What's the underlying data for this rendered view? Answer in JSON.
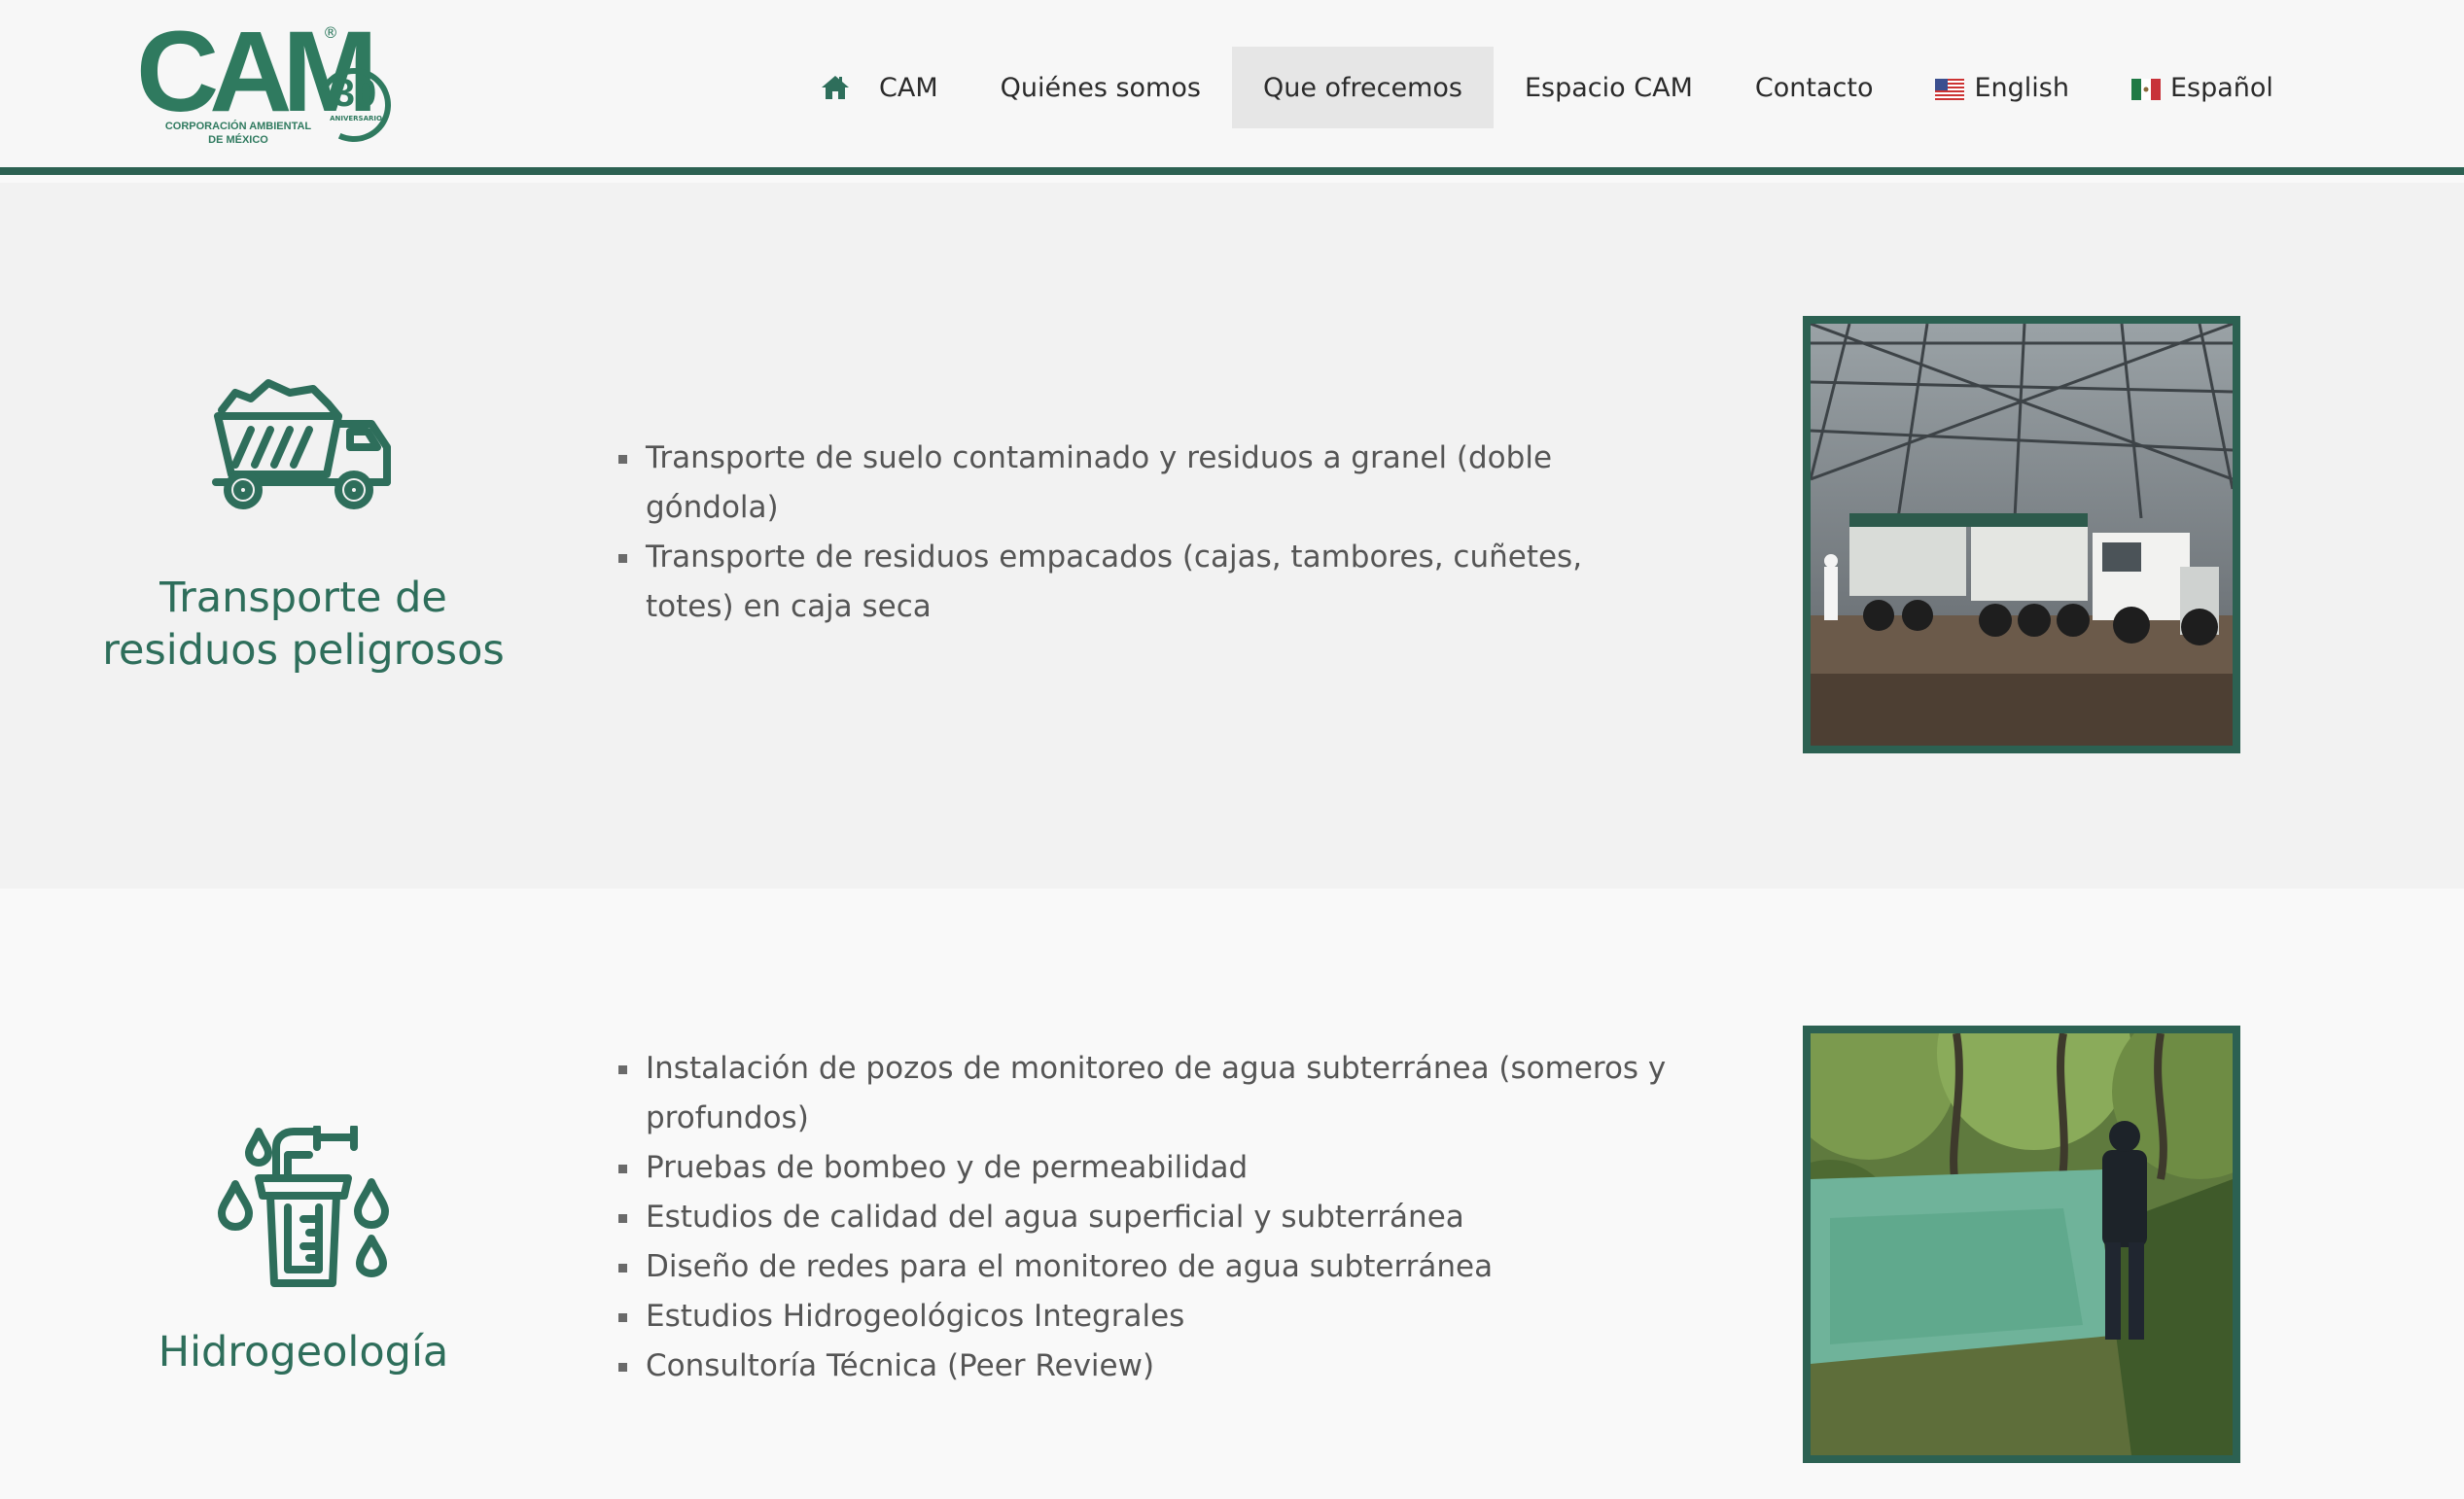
{
  "brand": {
    "logo_text": "CAM",
    "anniversary_number": "30",
    "anniversary_label": "ANIVERSARIO",
    "tagline_line1": "CORPORACIÓN AMBIENTAL",
    "tagline_line2": "DE MÉXICO",
    "registered_mark": "®",
    "color": "#2f7a5f"
  },
  "nav": {
    "items": [
      {
        "label": "CAM",
        "icon": "home-icon"
      },
      {
        "label": "Quiénes somos"
      },
      {
        "label": "Que ofrecemos",
        "active": true
      },
      {
        "label": "Espacio CAM"
      },
      {
        "label": "Contacto"
      },
      {
        "label": "English",
        "icon": "us-flag-icon"
      },
      {
        "label": "Español",
        "icon": "mexico-flag-icon"
      }
    ]
  },
  "services": [
    {
      "title": "Transporte de residuos peligrosos",
      "icon": "dump-truck-icon",
      "bullets": [
        "Transporte de suelo contaminado y residuos a granel (doble góndola)",
        "Transporte de residuos empacados (cajas, tambores, cuñetes, totes) en caja seca"
      ],
      "image": "truck-in-warehouse-photo"
    },
    {
      "title": "Hidrogeología",
      "icon": "water-sampling-icon",
      "bullets": [
        "Instalación de pozos de monitoreo de agua subterránea (someros y profundos)",
        "Pruebas de bombeo y de permeabilidad",
        "Estudios de calidad del agua superficial y subterránea",
        "Diseño de redes para el monitoreo de agua subterránea",
        "Estudios Hidrogeológicos Integrales",
        "Consultoría Técnica (Peer Review)"
      ],
      "image": "spring-with-person-photo"
    }
  ],
  "colors": {
    "accent": "#2c6152",
    "title": "#2e6e5b",
    "header_bg": "#f7f7f7",
    "active_nav_bg": "#e6e6e6"
  }
}
